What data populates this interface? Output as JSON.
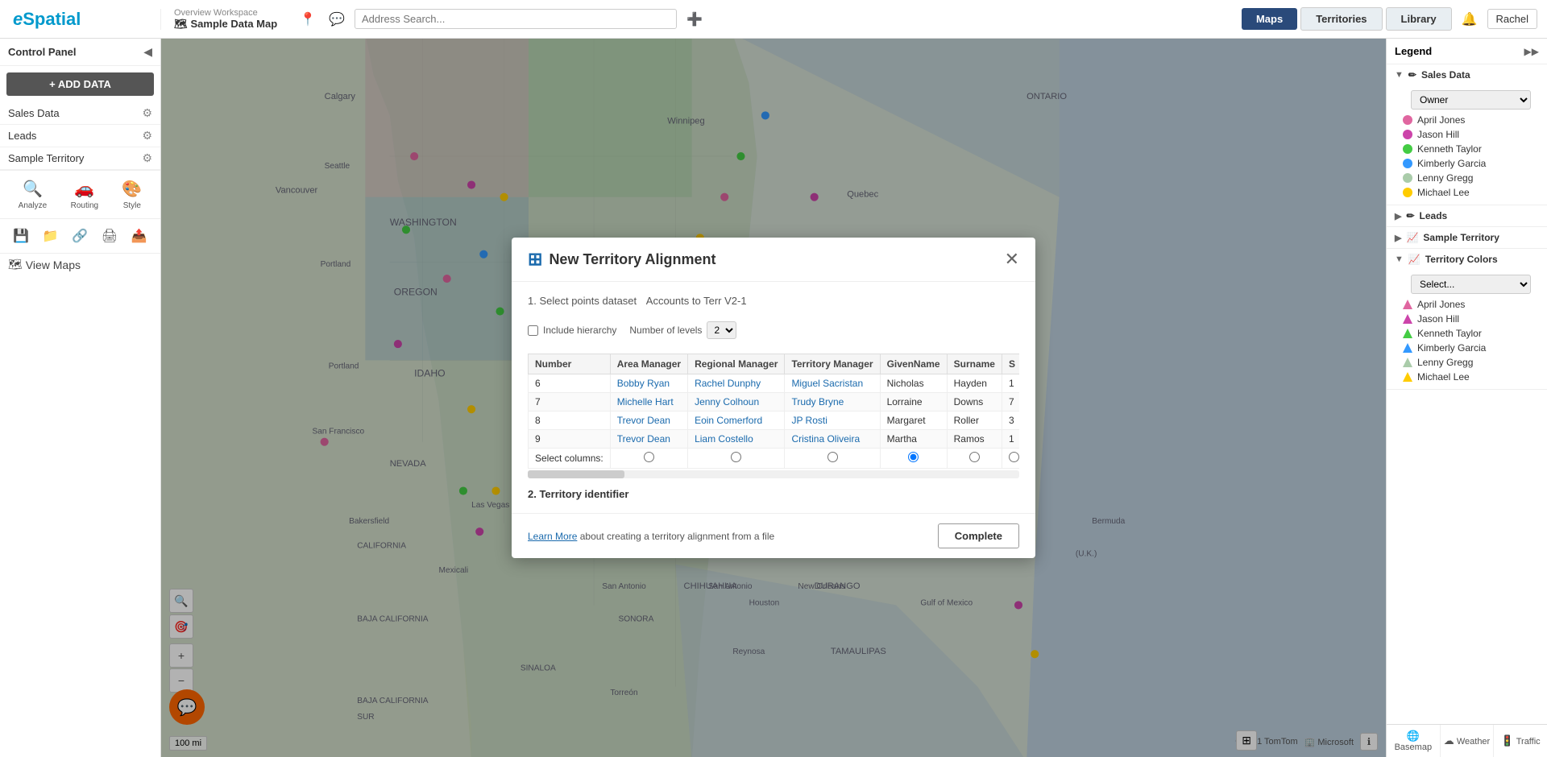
{
  "topbar": {
    "logo": "eSpatial",
    "overview_label": "Overview Workspace",
    "map_name": "Sample Data Map",
    "search_placeholder": "Address Search...",
    "nav_buttons": [
      "Maps",
      "Territories",
      "Library"
    ],
    "active_nav": "Maps",
    "user_label": "Rachel"
  },
  "left_panel": {
    "title": "Control Panel",
    "add_data_label": "+ ADD DATA",
    "layers": [
      {
        "name": "Sales Data"
      },
      {
        "name": "Leads"
      },
      {
        "name": "Sample Territory"
      }
    ],
    "tools": [
      {
        "label": "Analyze",
        "icon": "🔍"
      },
      {
        "label": "Routing",
        "icon": "🚗"
      },
      {
        "label": "Style",
        "icon": "🎨"
      }
    ],
    "bottom_tools": [
      "💾",
      "📁",
      "🔗",
      "🖨",
      "📤"
    ],
    "view_maps_label": "View Maps"
  },
  "legend": {
    "title": "Legend",
    "sections": [
      {
        "name": "Sales Data",
        "subsection": "Owner",
        "items": [
          {
            "label": "April Jones",
            "color": "#e066a0"
          },
          {
            "label": "Jason Hill",
            "color": "#cc44aa"
          },
          {
            "label": "Kenneth Taylor",
            "color": "#44cc44"
          },
          {
            "label": "Kimberly Garcia",
            "color": "#3399ff"
          },
          {
            "label": "Lenny Gregg",
            "color": "#aaccaa"
          },
          {
            "label": "Michael Lee",
            "color": "#ffcc00"
          }
        ]
      },
      {
        "name": "Leads",
        "items": []
      },
      {
        "name": "Sample Territory",
        "items": []
      },
      {
        "name": "Territory Colors",
        "items": [
          {
            "label": "April Jones",
            "color": "#e066a0"
          },
          {
            "label": "Jason Hill",
            "color": "#cc44aa"
          },
          {
            "label": "Kenneth Taylor",
            "color": "#44cc44"
          },
          {
            "label": "Kimberly Garcia",
            "color": "#3399ff"
          },
          {
            "label": "Lenny Gregg",
            "color": "#aaccaa"
          },
          {
            "label": "Michael Lee",
            "color": "#ffcc00"
          }
        ]
      }
    ],
    "bottom_tabs": [
      "Basemap",
      "Weather",
      "Traffic"
    ]
  },
  "modal": {
    "title": "New Territory Alignment",
    "step1_label": "1. Select points dataset",
    "dataset_value": "Accounts to Terr V2-1",
    "include_hierarchy_label": "Include hierarchy",
    "num_levels_label": "Number of levels",
    "num_levels_value": "2",
    "columns_label": "Select columns:",
    "step2_label": "2. Territory identifier",
    "table": {
      "headers": [
        "Number",
        "Area Manager",
        "Regional Manager",
        "Territory Manager",
        "GivenName",
        "Surname",
        "S"
      ],
      "rows": [
        {
          "num": "6",
          "area": "Bobby Ryan",
          "regional": "Rachel Dunphy",
          "territory": "Miguel Sacristan",
          "given": "Nicholas",
          "surname": "Hayden",
          "s": "1"
        },
        {
          "num": "7",
          "area": "Michelle Hart",
          "regional": "Jenny Colhoun",
          "territory": "Trudy Bryne",
          "given": "Lorraine",
          "surname": "Downs",
          "s": "7"
        },
        {
          "num": "8",
          "area": "Trevor Dean",
          "regional": "Eoin Comerford",
          "territory": "JP Rosti",
          "given": "Margaret",
          "surname": "Roller",
          "s": "3"
        },
        {
          "num": "9",
          "area": "Trevor Dean",
          "regional": "Liam Costello",
          "territory": "Cristina Oliveira",
          "given": "Martha",
          "surname": "Ramos",
          "s": "1"
        }
      ],
      "selected_col_index": 3
    },
    "footer_text": "about creating a territory alignment from a file",
    "learn_more_label": "Learn More",
    "complete_label": "Complete"
  }
}
